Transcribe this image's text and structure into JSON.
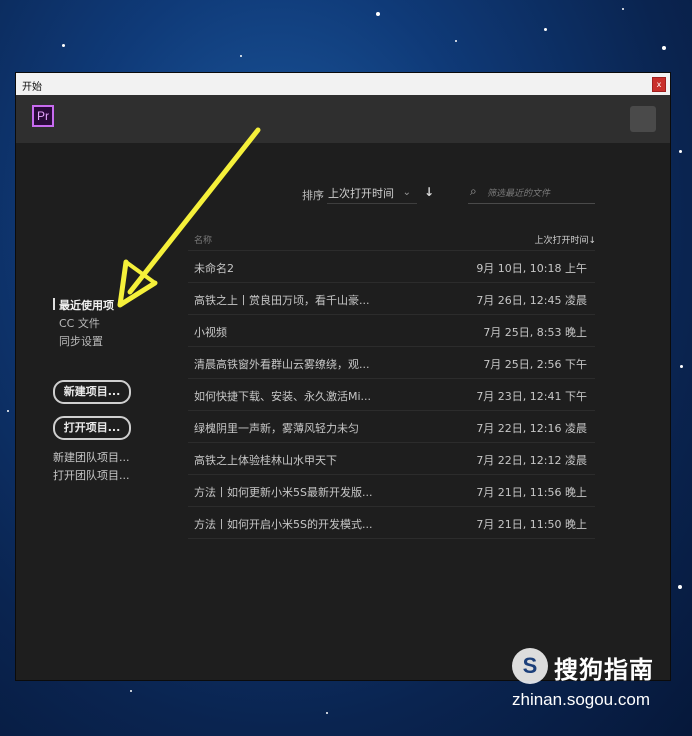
{
  "window": {
    "title": "开始",
    "close_label": "x"
  },
  "appbar": {
    "logo_text": "Pr"
  },
  "sidebar": {
    "links": [
      {
        "label": "最近使用项",
        "active": true
      },
      {
        "label": "CC 文件"
      },
      {
        "label": "同步设置"
      }
    ],
    "buttons": {
      "new_project": "新建项目...",
      "open_project": "打开项目..."
    },
    "team_links": [
      "新建团队项目...",
      "打开团队项目..."
    ]
  },
  "toolbar": {
    "sort_label": "排序",
    "sort_value": "上次打开时间",
    "search_placeholder": "筛选最近的文件"
  },
  "table": {
    "col_name": "名称",
    "col_date": "上次打开时间",
    "rows": [
      {
        "name": "未命名2",
        "date": "9月 10日, 10:18 上午"
      },
      {
        "name": "高铁之上丨赏良田万顷，看千山豪...",
        "date": "7月 26日, 12:45 凌晨"
      },
      {
        "name": "小视频",
        "date": "7月 25日, 8:53 晚上"
      },
      {
        "name": "清晨高铁窗外看群山云雾缭绕，观...",
        "date": "7月 25日, 2:56 下午"
      },
      {
        "name": "如何快捷下载、安装、永久激活Mi...",
        "date": "7月 23日, 12:41 下午"
      },
      {
        "name": "绿槐阴里一声新，雾薄风轻力未匀",
        "date": "7月 22日, 12:16 凌晨"
      },
      {
        "name": "高铁之上体验桂林山水甲天下",
        "date": "7月 22日, 12:12 凌晨"
      },
      {
        "name": "方法丨如何更新小米5S最新开发版...",
        "date": "7月 21日, 11:56 晚上"
      },
      {
        "name": "方法丨如何开启小米5S的开发模式...",
        "date": "7月 21日, 11:50 晚上"
      }
    ]
  },
  "watermark": {
    "logo": "S",
    "title": "搜狗指南",
    "url": "zhinan.sogou.com"
  },
  "colors": {
    "window_bg": "#1e1e1e",
    "appbar_bg": "#2f2f2f",
    "logo_accent": "#c86bf0",
    "annotation_arrow": "#f5f03a"
  },
  "icons": {
    "sort_direction": "arrow-down-icon",
    "search": "search-icon",
    "sort_dropdown": "chevron-down-icon"
  }
}
